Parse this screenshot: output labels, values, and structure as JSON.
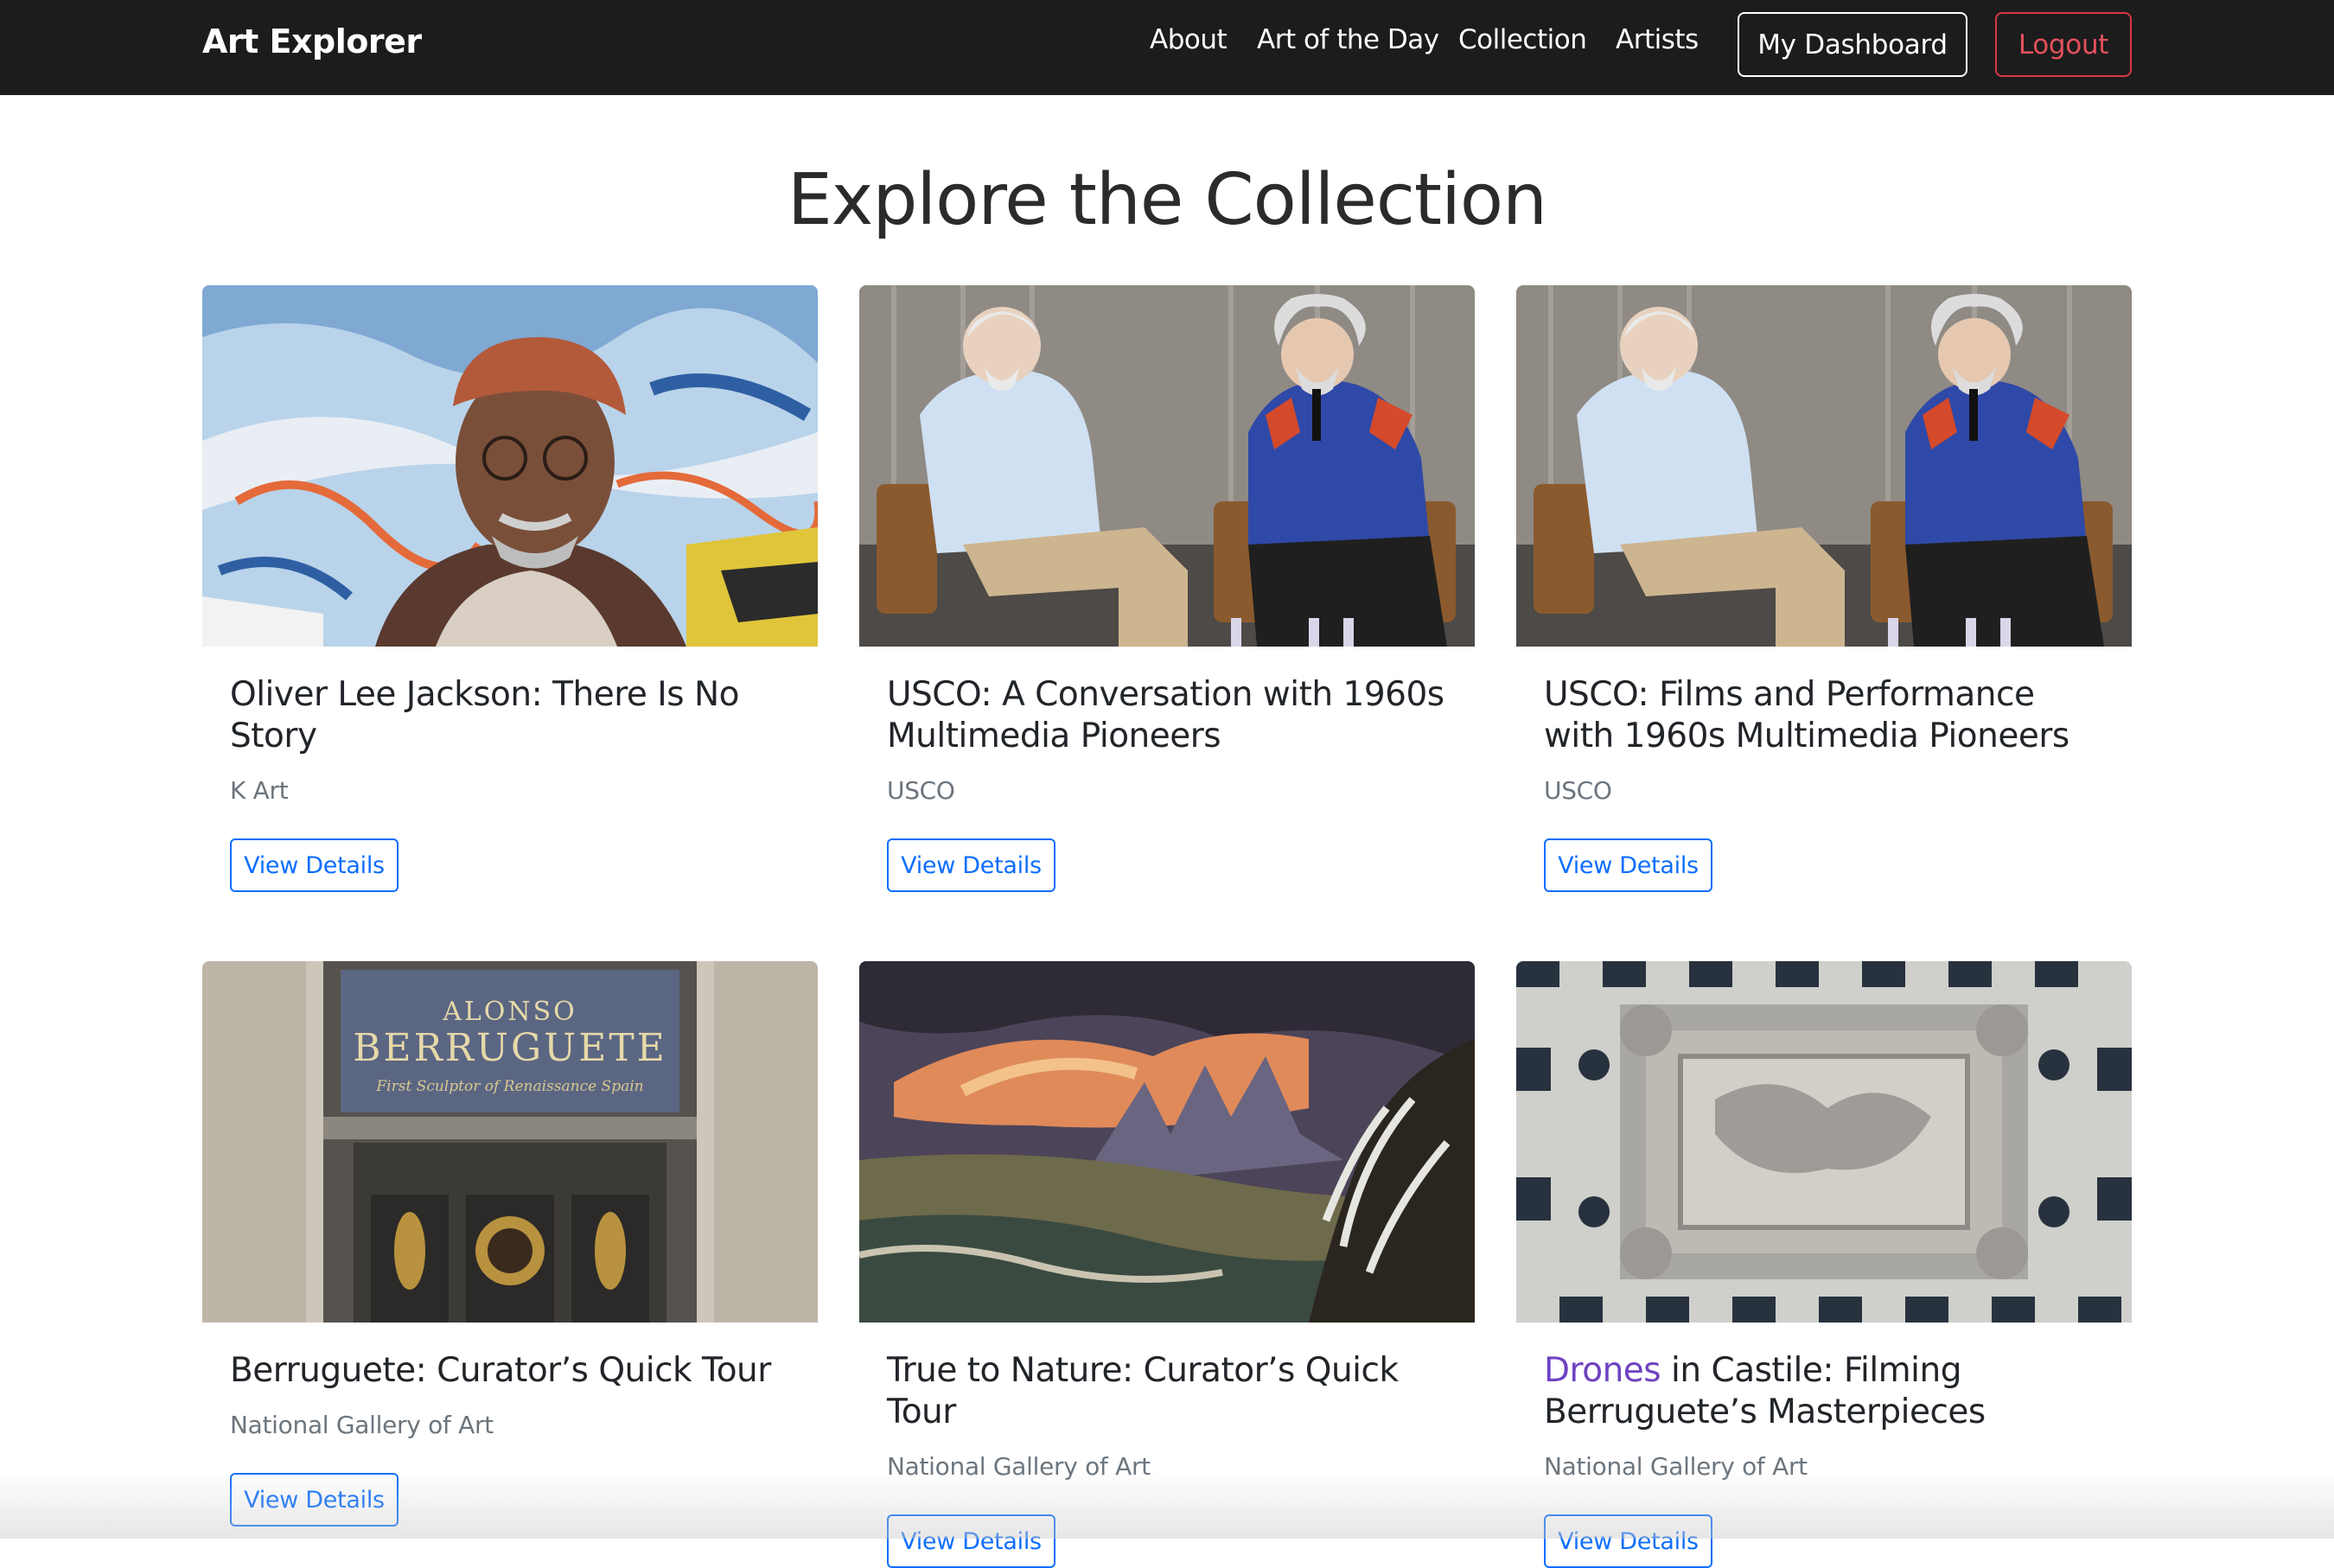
{
  "navbar": {
    "brand": "Art Explorer",
    "links": [
      "About",
      "Art of the Day",
      "Collection",
      "Artists"
    ],
    "dashboard_label": "My Dashboard",
    "logout_label": "Logout"
  },
  "main": {
    "title": "Explore the Collection",
    "cards": [
      {
        "title": "Oliver Lee Jackson: There Is No Story",
        "subtitle": "K Art",
        "button": "View Details",
        "image": "portrait-before-abstract-painting"
      },
      {
        "title": "USCO: A Conversation with 1960s Multimedia Pioneers",
        "subtitle": "USCO",
        "button": "View Details",
        "image": "two-men-seated-on-stage"
      },
      {
        "title": "USCO: Films and Performance with 1960s Multimedia Pioneers",
        "subtitle": "USCO",
        "button": "View Details",
        "image": "two-men-seated-on-stage"
      },
      {
        "title": "Berruguete: Curator’s Quick Tour",
        "subtitle": "National Gallery of Art",
        "button": "View Details",
        "image": "gallery-entrance-alonso-berruguete",
        "sign_line1": "ALONSO",
        "sign_line2": "BERRUGUETE",
        "sign_line3": "First Sculptor of Renaissance Spain"
      },
      {
        "title": "True to Nature: Curator’s Quick Tour",
        "subtitle": "National Gallery of Art",
        "button": "View Details",
        "image": "stormy-landscape-painting"
      },
      {
        "title_accent": "Drones",
        "title_rest": " in Castile: Filming Berruguete’s Masterpieces",
        "subtitle": "National Gallery of Art",
        "button": "View Details",
        "image": "aerial-view-stone-tomb"
      }
    ]
  },
  "colors": {
    "navbar_bg": "#1c1c1c",
    "link_blue": "#0d6efd",
    "logout_red": "#dc3545",
    "accent_purple": "#6f42c1"
  }
}
